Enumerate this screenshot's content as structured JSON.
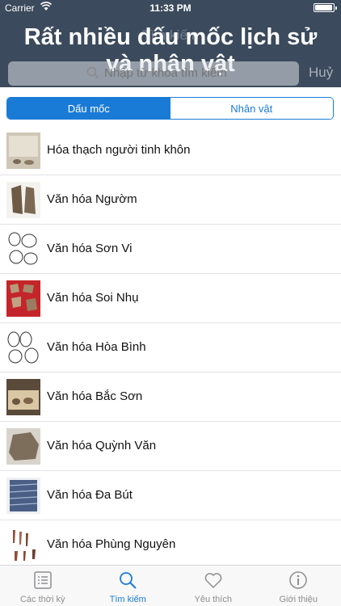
{
  "status_bar": {
    "carrier": "Carrier",
    "time": "11:33 PM",
    "battery_level": 0.95
  },
  "promo": {
    "ghost_title": "Tìm kiếm",
    "headline": "Rất nhiều dấu mốc lịch sử và nhân vật"
  },
  "search": {
    "placeholder": "Nhập từ khoá tìm kiếm",
    "cancel_label": "Huỷ"
  },
  "segments": {
    "milestones_label": "Dấu mốc",
    "people_label": "Nhân vật",
    "selected": "milestones"
  },
  "list": [
    {
      "title": "Hóa thạch người tinh khôn",
      "thumb": "fossil-display"
    },
    {
      "title": "Văn hóa Ngườm",
      "thumb": "stone-tool-brown"
    },
    {
      "title": "Văn hóa Sơn Vi",
      "thumb": "tool-sketches"
    },
    {
      "title": "Văn hóa Soi Nhụ",
      "thumb": "shards-on-red"
    },
    {
      "title": "Văn hóa Hòa Bình",
      "thumb": "tool-sketches"
    },
    {
      "title": "Văn hóa Bắc Sơn",
      "thumb": "museum-case"
    },
    {
      "title": "Văn hóa Quỳnh Văn",
      "thumb": "stone-artifact"
    },
    {
      "title": "Văn hóa Đa Bút",
      "thumb": "pottery-fragment"
    },
    {
      "title": "Văn hóa Phùng Nguyên",
      "thumb": "arrowheads"
    }
  ],
  "tabs": [
    {
      "label": "Các thời kỳ",
      "icon": "list-icon"
    },
    {
      "label": "Tìm kiếm",
      "icon": "search-icon"
    },
    {
      "label": "Yêu thích",
      "icon": "heart-icon"
    },
    {
      "label": "Giới thiệu",
      "icon": "info-icon"
    }
  ],
  "colors": {
    "accent": "#1a7bd6",
    "header": "#3b4a5c"
  }
}
